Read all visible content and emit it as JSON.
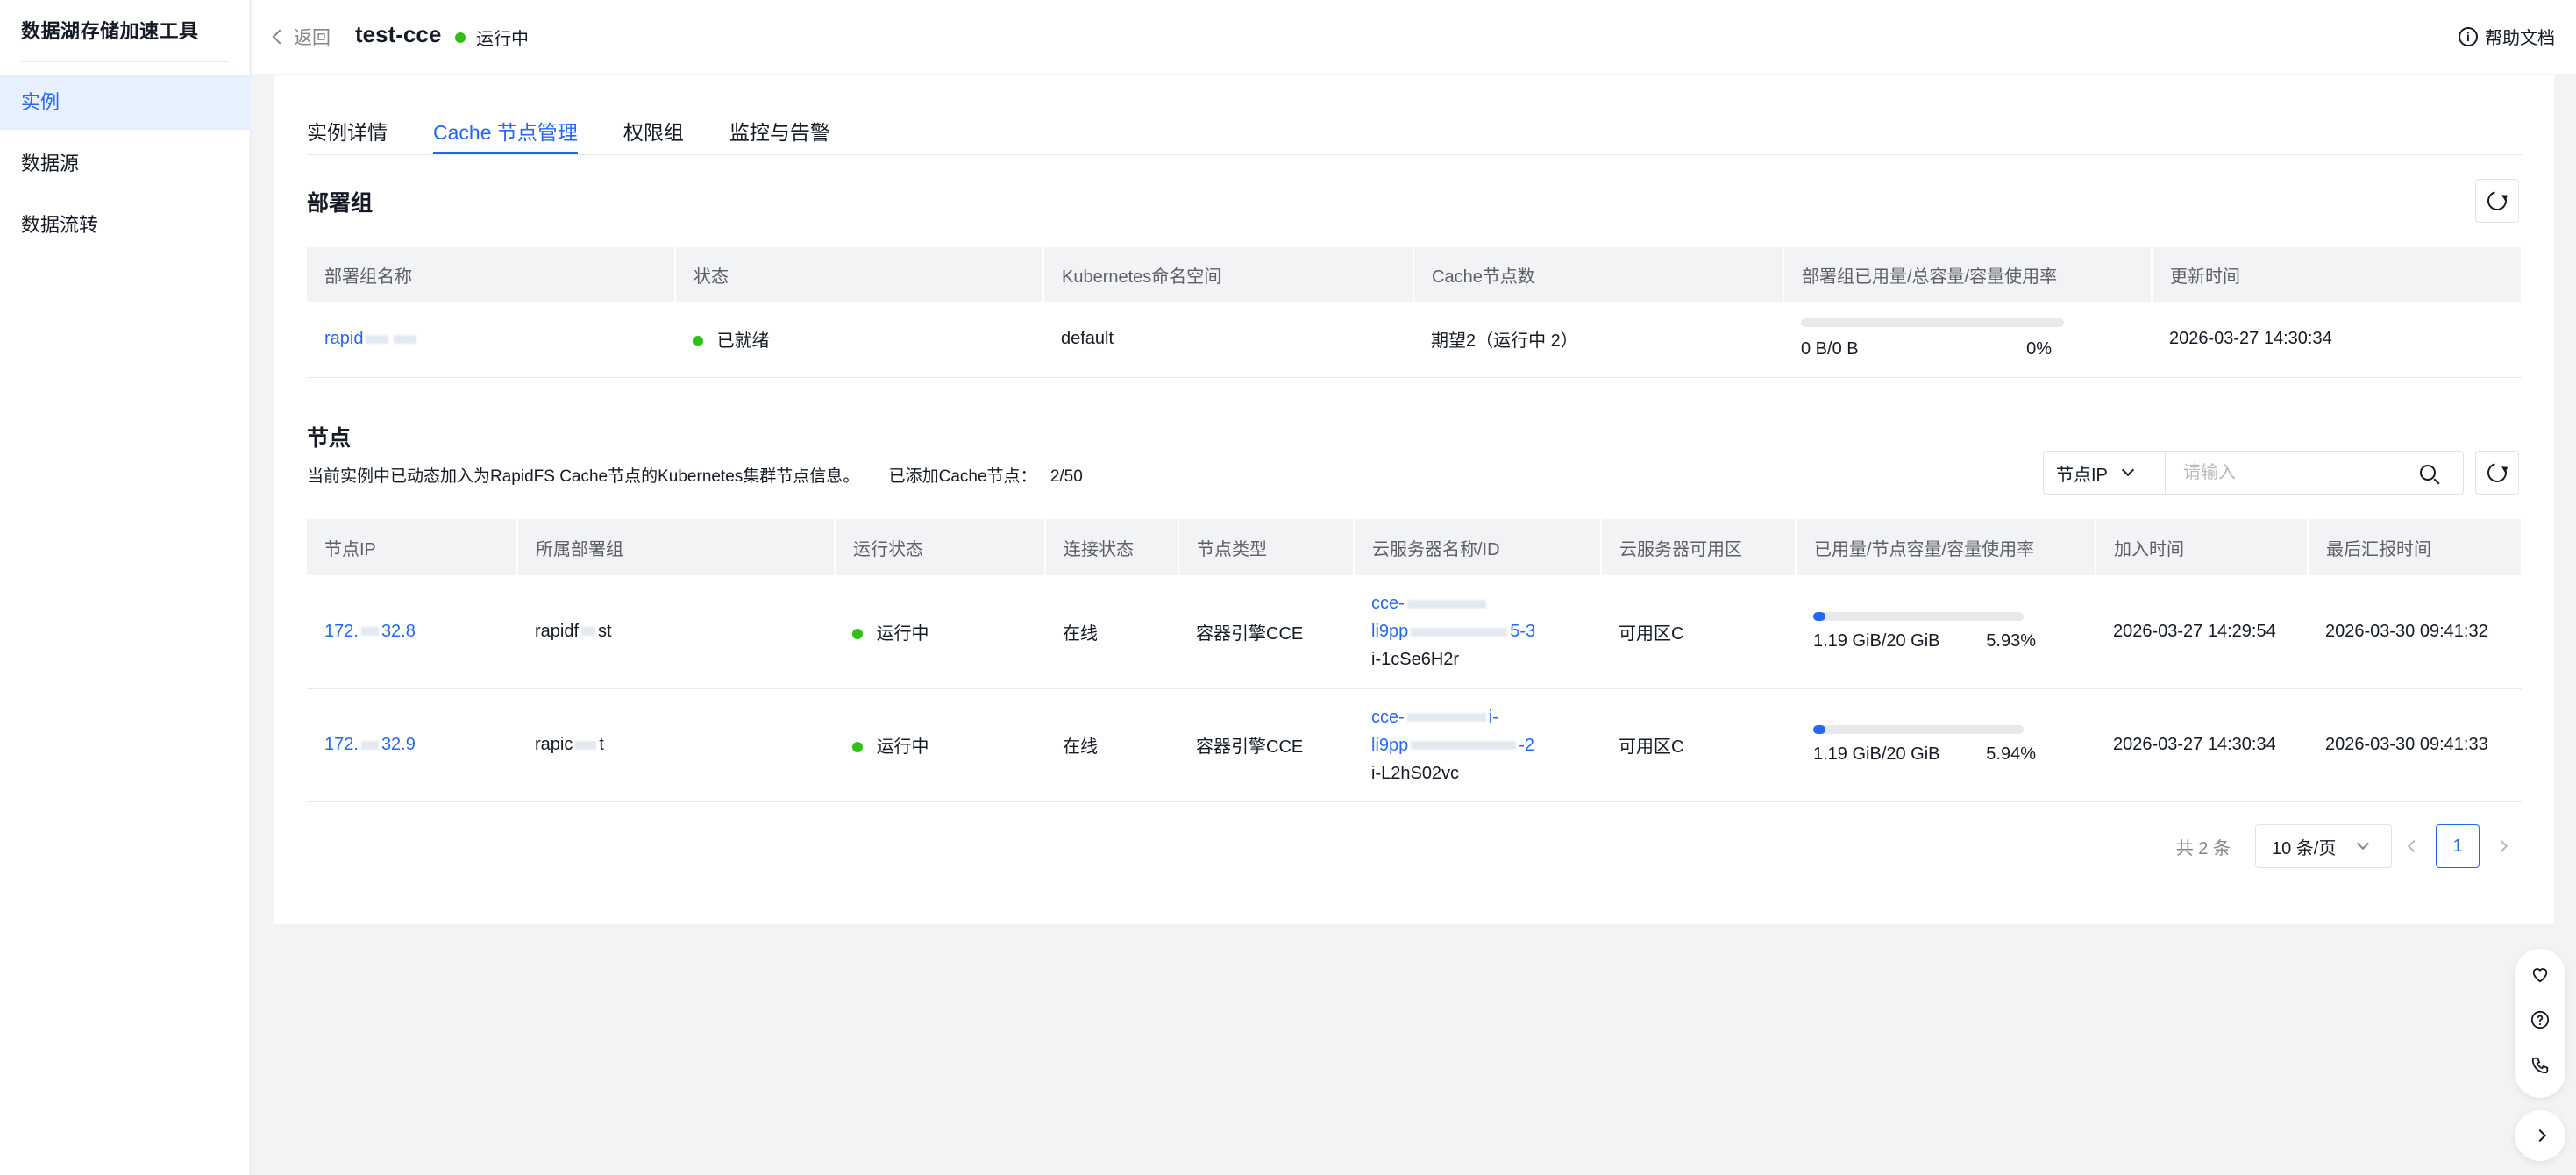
{
  "sidebar": {
    "title": "数据湖存储加速工具",
    "items": [
      {
        "label": "实例",
        "active": true
      },
      {
        "label": "数据源",
        "active": false
      },
      {
        "label": "数据流转",
        "active": false
      }
    ]
  },
  "header": {
    "back_label": "返回",
    "instance_name": "test-cce",
    "status": "运行中",
    "help_label": "帮助文档"
  },
  "tabs": [
    {
      "label": "实例详情",
      "active": false
    },
    {
      "label": "Cache 节点管理",
      "active": true
    },
    {
      "label": "权限组",
      "active": false
    },
    {
      "label": "监控与告警",
      "active": false
    }
  ],
  "deploy_group": {
    "title": "部署组",
    "columns": [
      "部署组名称",
      "状态",
      "Kubernetes命名空间",
      "Cache节点数",
      "部署组已用量/总容量/容量使用率",
      "更新时间"
    ],
    "rows": [
      {
        "name": "rapid",
        "status": "已就绪",
        "namespace": "default",
        "cache_nodes": "期望2（运行中 2）",
        "usage": "0 B/0 B",
        "usage_rate": "0%",
        "usage_fraction": 0,
        "updated": "2026-03-27 14:30:34"
      }
    ]
  },
  "nodes": {
    "title": "节点",
    "description": "当前实例中已动态加入为RapidFS Cache节点的Kubernetes集群节点信息。",
    "added_label": "已添加Cache节点：",
    "added_count": "2/50",
    "filter_select": "节点IP",
    "search_placeholder": "请输入",
    "columns": [
      "节点IP",
      "所属部署组",
      "运行状态",
      "连接状态",
      "节点类型",
      "云服务器名称/ID",
      "云服务器可用区",
      "已用量/节点容量/容量使用率",
      "加入时间",
      "最后汇报时间"
    ],
    "rows": [
      {
        "ip_a": "172.",
        "ip_b": "32.8",
        "group_a": "rapidf",
        "group_b": "st",
        "run_status": "运行中",
        "conn_status": "在线",
        "node_type": "容器引擎CCE",
        "server_line1": "cce-",
        "server_line2_a": "li9pp",
        "server_line2_b": "5-3",
        "server_id": "i-1cSe6H2r",
        "zone": "可用区C",
        "usage": "1.19 GiB/20 GiB",
        "usage_rate": "5.93%",
        "usage_fraction": 0.0593,
        "joined": "2026-03-27 14:29:54",
        "last_report": "2026-03-30 09:41:32"
      },
      {
        "ip_a": "172.",
        "ip_b": "32.9",
        "group_a": "rapic",
        "group_b": "t",
        "run_status": "运行中",
        "conn_status": "在线",
        "node_type": "容器引擎CCE",
        "server_line1": "cce-",
        "server_line1_b": "i-",
        "server_line2_a": "li9pp",
        "server_line2_b": "-2",
        "server_id": "i-L2hS02vc",
        "zone": "可用区C",
        "usage": "1.19 GiB/20 GiB",
        "usage_rate": "5.94%",
        "usage_fraction": 0.0594,
        "joined": "2026-03-27 14:30:34",
        "last_report": "2026-03-30 09:41:33"
      }
    ]
  },
  "pagination": {
    "total": "共 2 条",
    "page_size": "10 条/页",
    "current_page": "1"
  },
  "colors": {
    "accent": "#2468f2",
    "running": "#30bf13"
  },
  "floating_icons": [
    "heart-icon",
    "question-icon",
    "phone-icon",
    "chevron-right-icon"
  ]
}
